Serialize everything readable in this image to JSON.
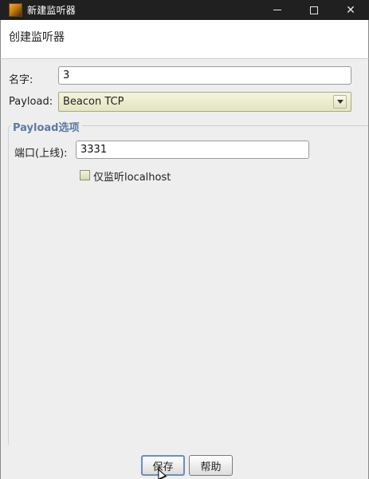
{
  "window": {
    "title": "新建监听器",
    "icon": "app-icon"
  },
  "header": {
    "heading": "创建监听器"
  },
  "form": {
    "name_label": "名字:",
    "name_value": "3",
    "payload_label": "Payload:",
    "payload_value": "Beacon TCP",
    "options_legend": "Payload选项",
    "port_label": "端口(上线):",
    "port_value": "3331",
    "localhost_label": "仅监听localhost",
    "localhost_checked": false
  },
  "buttons": {
    "save": "保存",
    "help": "帮助"
  },
  "colors": {
    "titlebar": "#202020",
    "legend": "#5a7ba3",
    "select_bg": "#e4e5c2"
  }
}
